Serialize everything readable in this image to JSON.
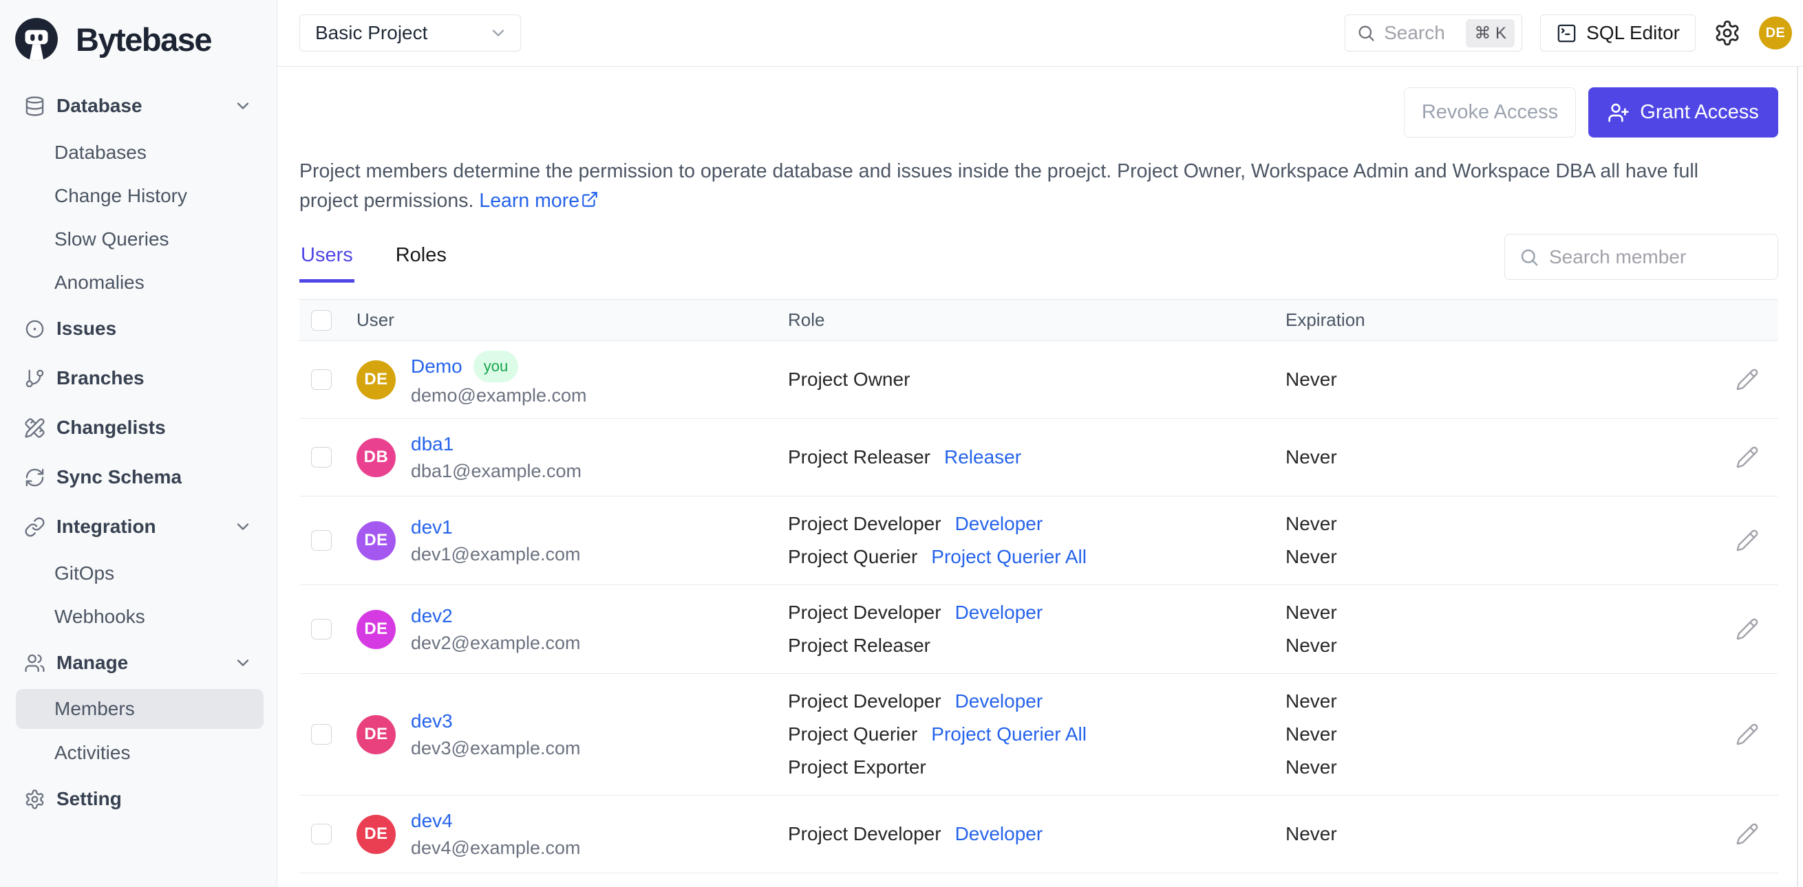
{
  "brand": {
    "name": "Bytebase"
  },
  "topbar": {
    "project_select": "Basic Project",
    "search_placeholder": "Search",
    "search_shortcut": "⌘ K",
    "sql_editor_label": "SQL Editor",
    "avatar_initials": "DE",
    "avatar_color": "#d6a40d"
  },
  "sidebar": {
    "items": [
      {
        "label": "Database",
        "icon": "database-icon",
        "type": "parent",
        "chevron": true,
        "active": false
      },
      {
        "label": "Databases",
        "type": "sub",
        "active": false
      },
      {
        "label": "Change History",
        "type": "sub",
        "active": false
      },
      {
        "label": "Slow Queries",
        "type": "sub",
        "active": false
      },
      {
        "label": "Anomalies",
        "type": "sub",
        "active": false
      },
      {
        "label": "Issues",
        "icon": "issues-icon",
        "type": "parent",
        "chevron": false,
        "active": false
      },
      {
        "label": "Branches",
        "icon": "branch-icon",
        "type": "parent",
        "chevron": false,
        "active": false
      },
      {
        "label": "Changelists",
        "icon": "changelist-icon",
        "type": "parent",
        "chevron": false,
        "active": false
      },
      {
        "label": "Sync Schema",
        "icon": "sync-icon",
        "type": "parent",
        "chevron": false,
        "active": false
      },
      {
        "label": "Integration",
        "icon": "link-icon",
        "type": "parent",
        "chevron": true,
        "active": false
      },
      {
        "label": "GitOps",
        "type": "sub",
        "active": false
      },
      {
        "label": "Webhooks",
        "type": "sub",
        "active": false
      },
      {
        "label": "Manage",
        "icon": "users-icon",
        "type": "parent",
        "chevron": true,
        "active": false
      },
      {
        "label": "Members",
        "type": "sub",
        "active": true
      },
      {
        "label": "Activities",
        "type": "sub",
        "active": false
      },
      {
        "label": "Setting",
        "icon": "gear-icon",
        "type": "parent",
        "chevron": false,
        "active": false
      }
    ]
  },
  "page": {
    "actions": {
      "revoke_label": "Revoke Access",
      "grant_label": "Grant Access"
    },
    "description": {
      "text": "Project members determine the permission to operate database and issues inside the proejct. Project Owner, Workspace Admin and Workspace DBA all have full project permissions. ",
      "link_label": "Learn more"
    },
    "tabs": [
      {
        "label": "Users",
        "active": true
      },
      {
        "label": "Roles",
        "active": false
      }
    ],
    "member_search_placeholder": "Search member",
    "accent_color": "#4f46e5",
    "link_color": "#2563eb",
    "table": {
      "columns": [
        "User",
        "Role",
        "Expiration"
      ],
      "rows": [
        {
          "initials": "DE",
          "avatar_color": "#d6a40d",
          "name": "Demo",
          "you_badge": "you",
          "email": "demo@example.com",
          "roles": [
            {
              "role": "Project Owner",
              "link": "",
              "expiration": "Never"
            }
          ]
        },
        {
          "initials": "DB",
          "avatar_color": "#e9418f",
          "name": "dba1",
          "you_badge": "",
          "email": "dba1@example.com",
          "roles": [
            {
              "role": "Project Releaser",
              "link": "Releaser",
              "expiration": "Never"
            }
          ]
        },
        {
          "initials": "DE",
          "avatar_color": "#a558f0",
          "name": "dev1",
          "you_badge": "",
          "email": "dev1@example.com",
          "roles": [
            {
              "role": "Project Developer",
              "link": "Developer",
              "expiration": "Never"
            },
            {
              "role": "Project Querier",
              "link": "Project Querier All",
              "expiration": "Never"
            }
          ]
        },
        {
          "initials": "DE",
          "avatar_color": "#d63ae2",
          "name": "dev2",
          "you_badge": "",
          "email": "dev2@example.com",
          "roles": [
            {
              "role": "Project Developer",
              "link": "Developer",
              "expiration": "Never"
            },
            {
              "role": "Project Releaser",
              "link": "",
              "expiration": "Never"
            }
          ]
        },
        {
          "initials": "DE",
          "avatar_color": "#e8417e",
          "name": "dev3",
          "you_badge": "",
          "email": "dev3@example.com",
          "roles": [
            {
              "role": "Project Developer",
              "link": "Developer",
              "expiration": "Never"
            },
            {
              "role": "Project Querier",
              "link": "Project Querier All",
              "expiration": "Never"
            },
            {
              "role": "Project Exporter",
              "link": "",
              "expiration": "Never"
            }
          ]
        },
        {
          "initials": "DE",
          "avatar_color": "#ea3e52",
          "name": "dev4",
          "you_badge": "",
          "email": "dev4@example.com",
          "roles": [
            {
              "role": "Project Developer",
              "link": "Developer",
              "expiration": "Never"
            }
          ]
        }
      ]
    }
  }
}
